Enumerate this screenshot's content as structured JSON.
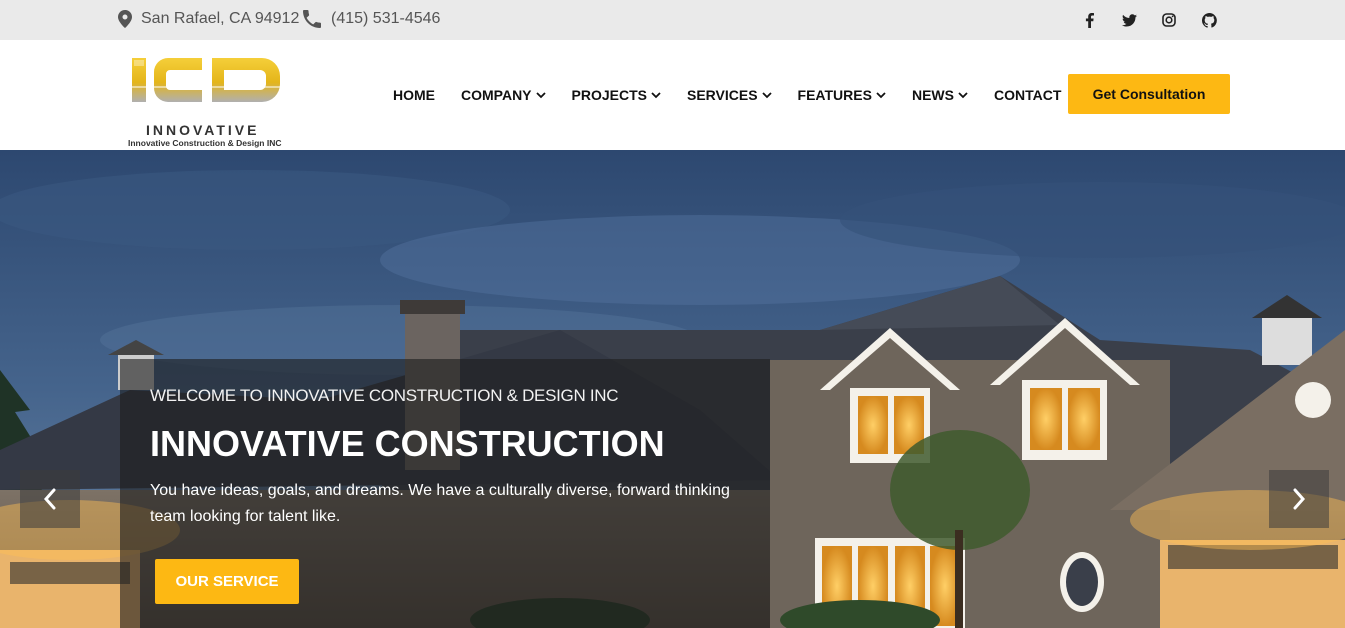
{
  "topbar": {
    "location": "San Rafael, CA 94912",
    "phone": "(415) 531-4546",
    "social": [
      "facebook-icon",
      "twitter-icon",
      "instagram-icon",
      "github-icon"
    ]
  },
  "logo": {
    "letters": "ICD",
    "name": "INNOVATIVE",
    "tagline": "Innovative Construction & Design INC"
  },
  "nav": {
    "items": [
      {
        "label": "HOME",
        "dropdown": false
      },
      {
        "label": "COMPANY",
        "dropdown": true
      },
      {
        "label": "PROJECTS",
        "dropdown": true
      },
      {
        "label": "SERVICES",
        "dropdown": true
      },
      {
        "label": "FEATURES",
        "dropdown": true
      },
      {
        "label": "NEWS",
        "dropdown": true
      },
      {
        "label": "CONTACT",
        "dropdown": false
      }
    ],
    "cta_label": "Get Consultation"
  },
  "hero": {
    "welcome": "WELCOME TO INNOVATIVE CONSTRUCTION & DESIGN INC",
    "headline": "INNOVATIVE CONSTRUCTION",
    "description": "You have ideas, goals, and dreams. We have a culturally diverse, forward thinking team looking for talent like.",
    "button_label": "OUR SERVICE"
  },
  "colors": {
    "accent": "#fdb813",
    "topbar_bg": "#eaeaea",
    "sky": "#3c5a80",
    "roof": "#3a3f4a"
  }
}
